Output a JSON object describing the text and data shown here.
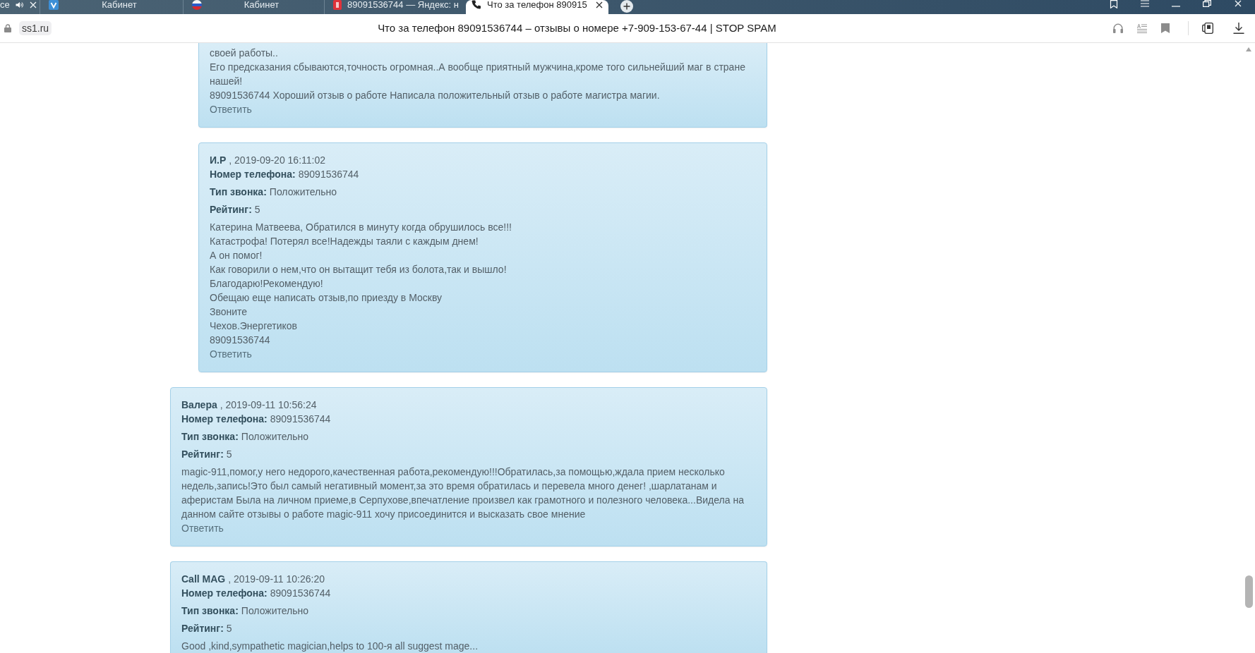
{
  "browser": {
    "tabs": [
      {
        "title": "се",
        "selected": false,
        "audio": true,
        "close_shown": true
      },
      {
        "title": "Кабинет",
        "selected": false,
        "audio": false,
        "close_shown": false
      },
      {
        "title": "Кабинет",
        "selected": false,
        "audio": false,
        "close_shown": false
      },
      {
        "title": "89091536744 — Яндекс: н",
        "selected": false,
        "audio": false,
        "close_shown": false
      },
      {
        "title": "Что за телефон 890915",
        "selected": true,
        "audio": false,
        "close_shown": true
      }
    ],
    "address_bar": {
      "domain": "ss1.ru",
      "page_title": "Что за телефон 89091536744 – отзывы о номере +7-909-153-67-44 | STOP SPAM"
    }
  },
  "comments": [
    {
      "children": [
        {
          "body": [
            "своей работы..",
            "Его предсказания сбываются,точность огромная..А вообще приятный мужчина,кроме того сильнейший маг в стране нашей!",
            "89091536744 Хороший отзыв о работе Написала положительный отзыв о работе магистра магии."
          ],
          "reply_link": "Ответить"
        },
        {
          "author": "И.Р",
          "date": ", 2019-09-20 16:11:02",
          "fields": [
            {
              "label": "Номер телефона:",
              "value": "89091536744"
            },
            {
              "label": "Тип звонка:",
              "value": "Положительно"
            },
            {
              "label": "Рейтинг:",
              "value": "5"
            }
          ],
          "body": [
            "Катерина Матвеева, Обратился в минуту когда обрушилось все!!!",
            "Катастрофа! Потерял все!Надежды таяли с каждым днем!",
            "А он помог!",
            "Как говорили о нем,что он вытащит тебя из болота,так и вышло!",
            "Благодарю!Рекомендую!",
            "Обещаю еще написать отзыв,по приезду в Москву",
            "Звоните",
            "Чехов.Энергетиков",
            "89091536744"
          ],
          "reply_link": "Ответить"
        }
      ]
    },
    {
      "author": "Валера",
      "date": ", 2019-09-11 10:56:24",
      "fields": [
        {
          "label": "Номер телефона:",
          "value": "89091536744"
        },
        {
          "label": "Тип звонка:",
          "value": "Положительно"
        },
        {
          "label": "Рейтинг:",
          "value": "5"
        }
      ],
      "body": [
        "magic-911,помог,у него недорого,качественная работа,рекомендую!!!Обратилась,за помощью,ждала прием несколько недель,запись!Это был самый негативный момент,за это время обратилась и перевела много денег! ,шарлатанам и аферистам Была на личном приеме,в Серпухове,впечатление произвел как грамотного и полезного человека...Видела на данном сайте отзывы о работе magic-911 хочу присоединится и высказать свое мнение"
      ],
      "reply_link": "Ответить"
    },
    {
      "author": "Call MAG",
      "date": ", 2019-09-11 10:26:20",
      "fields": [
        {
          "label": "Номер телефона:",
          "value": "89091536744"
        },
        {
          "label": "Тип звонка:",
          "value": "Положительно"
        },
        {
          "label": "Рейтинг:",
          "value": "5"
        }
      ],
      "body": [
        "Good ,kind,sympathetic magician,helps to 100-я all suggest mage..."
      ]
    }
  ]
}
